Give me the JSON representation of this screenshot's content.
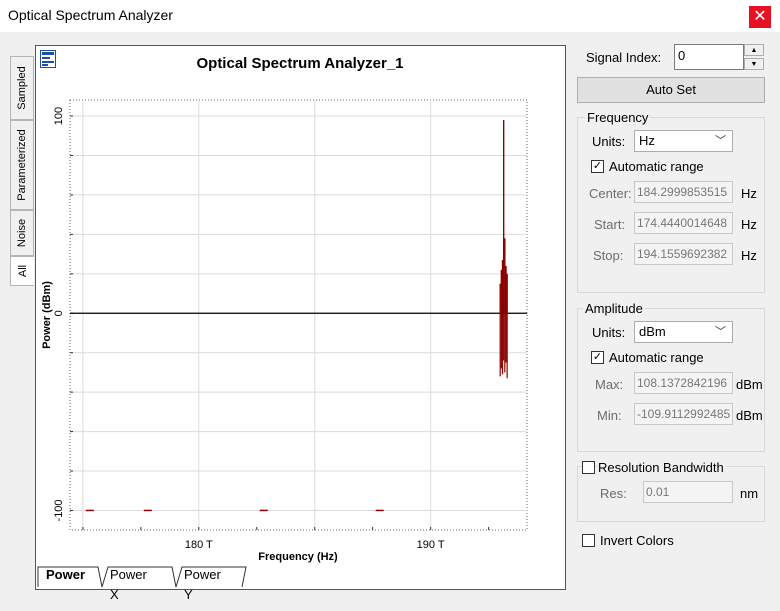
{
  "window": {
    "title": "Optical Spectrum Analyzer",
    "close_glyph": "✕"
  },
  "side_tabs": [
    {
      "label": "Sampled"
    },
    {
      "label": "Parameterized"
    },
    {
      "label": "Noise"
    },
    {
      "label": "All"
    }
  ],
  "bottom_tabs": [
    {
      "label": "Power"
    },
    {
      "label": "Power X"
    },
    {
      "label": "Power Y"
    }
  ],
  "controls": {
    "signal_index_label": "Signal Index:",
    "signal_index_value": "0",
    "auto_set_label": "Auto Set",
    "frequency": {
      "group_label": "Frequency",
      "units_label": "Units:",
      "units_value": "Hz",
      "auto_range_label": "Automatic range",
      "auto_range_checked": true,
      "center_label": "Center:",
      "center_value": "184.2999853515",
      "center_unit": "Hz",
      "start_label": "Start:",
      "start_value": "174.4440014648",
      "start_unit": "Hz",
      "stop_label": "Stop:",
      "stop_value": "194.1559692382",
      "stop_unit": "Hz"
    },
    "amplitude": {
      "group_label": "Amplitude",
      "units_label": "Units:",
      "units_value": "dBm",
      "auto_range_label": "Automatic range",
      "auto_range_checked": true,
      "max_label": "Max:",
      "max_value": "108.1372842196",
      "max_unit": "dBm",
      "min_label": "Min:",
      "min_value": "-109.9112992485",
      "min_unit": "dBm"
    },
    "resolution": {
      "checkbox_label": "Resolution Bandwidth",
      "checked": false,
      "res_label": "Res:",
      "res_value": "0.01",
      "res_unit": "nm"
    },
    "invert_colors_label": "Invert Colors",
    "invert_colors_checked": false
  },
  "chart_data": {
    "type": "line",
    "title": "Optical Spectrum Analyzer_1",
    "xlabel": "Frequency (Hz)",
    "ylabel": "Power (dBm)",
    "xlim": [
      174.444,
      194.156
    ],
    "ylim": [
      -109.91,
      108.14
    ],
    "x_ticks": [
      {
        "value": 180,
        "label": "180 T"
      },
      {
        "value": 190,
        "label": "190 T"
      }
    ],
    "y_ticks": [
      {
        "value": 100,
        "label": "100"
      },
      {
        "value": 0,
        "label": "0"
      },
      {
        "value": -100,
        "label": "-100"
      }
    ],
    "grid": true,
    "series_color": "#8b0000",
    "noise_floor_markers": {
      "y": -100,
      "x": [
        175.3,
        177.8,
        182.8,
        187.8
      ]
    },
    "peaks": [
      {
        "x": 193.15,
        "y": 98
      },
      {
        "x": 193.2,
        "y": 38
      },
      {
        "x": 193.1,
        "y": 27
      },
      {
        "x": 193.25,
        "y": 24
      },
      {
        "x": 193.05,
        "y": 22
      },
      {
        "x": 193.3,
        "y": 20
      },
      {
        "x": 193.0,
        "y": 15
      }
    ],
    "dips": [
      {
        "x": 193.0,
        "y": -32
      },
      {
        "x": 193.05,
        "y": -28
      },
      {
        "x": 193.1,
        "y": -31
      },
      {
        "x": 193.15,
        "y": -24
      },
      {
        "x": 193.2,
        "y": -30
      },
      {
        "x": 193.25,
        "y": -25
      },
      {
        "x": 193.3,
        "y": -33
      }
    ]
  }
}
